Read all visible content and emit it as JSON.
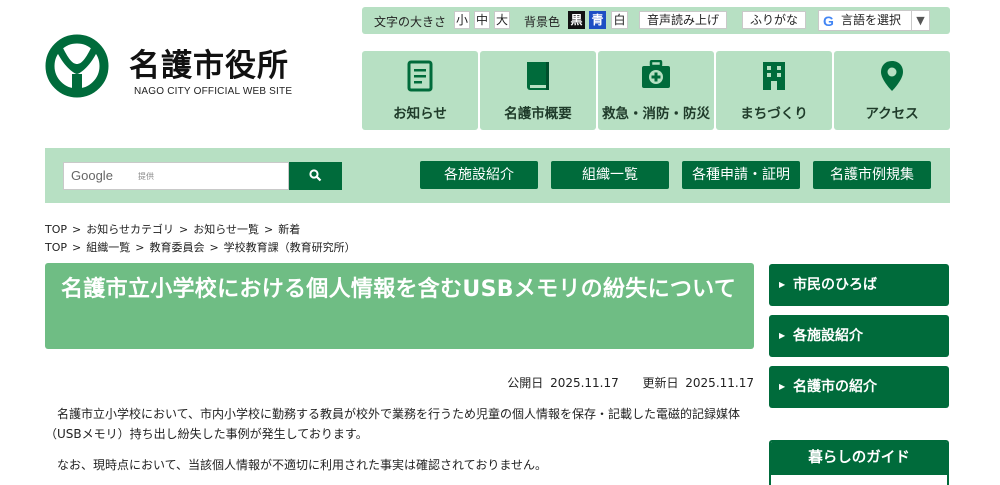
{
  "header": {
    "site_title": "名護市役所",
    "site_subtitle": "NAGO CITY OFFICIAL WEB SITE"
  },
  "utility": {
    "font_size_label": "文字の大きさ",
    "font_sizes": [
      "小",
      "中",
      "大"
    ],
    "bg_color_label": "背景色",
    "bg_colors": [
      "黒",
      "青",
      "白"
    ],
    "read_aloud": "音声読み上げ",
    "furigana": "ふりがな",
    "translate": "言語を選択"
  },
  "global_nav": [
    {
      "label": "お知らせ",
      "icon": "document-icon"
    },
    {
      "label": "名護市概要",
      "icon": "book-icon"
    },
    {
      "label": "救急・消防・防災",
      "icon": "first-aid-icon"
    },
    {
      "label": "まちづくり",
      "icon": "building-icon"
    },
    {
      "label": "アクセス",
      "icon": "map-pin-icon"
    }
  ],
  "search": {
    "brand": "Google",
    "provided": "提供"
  },
  "band_buttons": [
    "各施設紹介",
    "組織一覧",
    "各種申請・証明",
    "名護市例規集"
  ],
  "breadcrumbs": [
    [
      "TOP",
      "お知らせカテゴリ",
      "お知らせ一覧",
      "新着"
    ],
    [
      "TOP",
      "組織一覧",
      "教育委員会",
      "学校教育課（教育研究所）"
    ]
  ],
  "article": {
    "title": "名護市立小学校における個人情報を含むUSBメモリの紛失について",
    "published_label": "公開日",
    "published": "2025.11.17",
    "updated_label": "更新日",
    "updated": "2025.11.17",
    "paragraphs": [
      "名護市立小学校において、市内小学校に勤務する教員が校外で業務を行うため児童の個人情報を保存・記載した電磁的記録媒体（USBメモリ）持ち出し紛失した事例が発生しております。",
      "なお、現時点において、当該個人情報が不適切に利用された事実は確認されておりません。"
    ]
  },
  "sidebar": {
    "buttons": [
      "市民のひろば",
      "各施設紹介",
      "名護市の紹介"
    ],
    "guide_title": "暮らしのガイド"
  },
  "colors": {
    "brand_green": "#006b3b",
    "light_green": "#b7e0c3",
    "heading_green": "#6fbd84"
  }
}
